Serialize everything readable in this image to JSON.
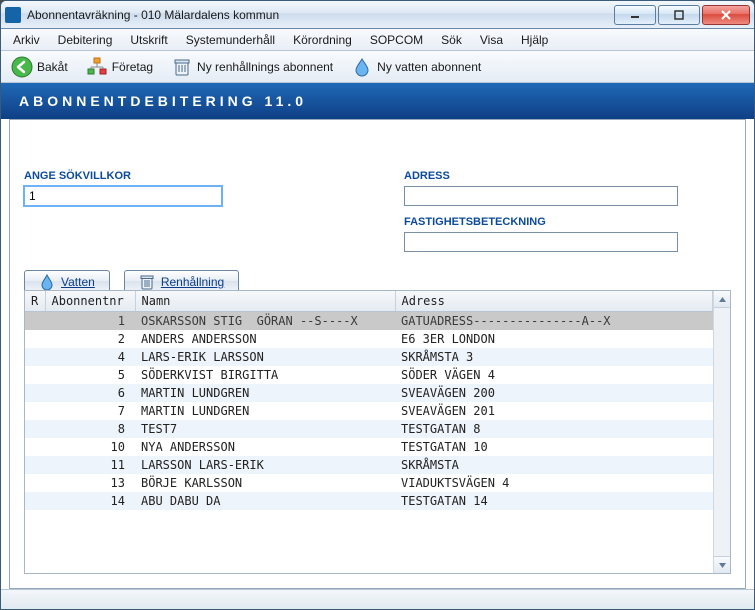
{
  "window": {
    "title": "Abonnentavräkning  -  010 Mälardalens kommun"
  },
  "menubar": [
    "Arkiv",
    "Debitering",
    "Utskrift",
    "Systemunderhåll",
    "Körordning",
    "SOPCOM",
    "Sök",
    "Visa",
    "Hjälp"
  ],
  "toolbar": {
    "back": "Bakåt",
    "company": "Företag",
    "new_ren": "Ny renhållnings abonnent",
    "new_vatten": "Ny vatten abonnent"
  },
  "band": "ABONNENTDEBITERING  11.0",
  "form": {
    "search_label": "ANGE SÖKVILLKOR",
    "search_value": "1",
    "adress_label": "ADRESS",
    "adress_value": "",
    "fast_label": "FASTIGHETSBETECKNING",
    "fast_value": "",
    "btn_vatten": "Vatten",
    "btn_ren": "Renhållning"
  },
  "table": {
    "headers": {
      "r": "R",
      "nr": "Abonnentnr",
      "namn": "Namn",
      "adress": "Adress"
    },
    "rows": [
      {
        "nr": "1",
        "namn": "OSKARSSON STIG  GÖRAN --S----X",
        "adress": "GATUADRESS---------------A--X",
        "sel": true
      },
      {
        "nr": "2",
        "namn": "ANDERS ANDERSSON",
        "adress": "E6 3ER LONDON"
      },
      {
        "nr": "4",
        "namn": "LARS-ERIK LARSSON",
        "adress": "SKRÅMSTA 3"
      },
      {
        "nr": "5",
        "namn": "SÖDERKVIST BIRGITTA",
        "adress": "SÖDER VÄGEN 4"
      },
      {
        "nr": "6",
        "namn": "MARTIN LUNDGREN",
        "adress": "SVEAVÄGEN 200"
      },
      {
        "nr": "7",
        "namn": "MARTIN LUNDGREN",
        "adress": "SVEAVÄGEN 201"
      },
      {
        "nr": "8",
        "namn": "TEST7",
        "adress": "TESTGATAN 8"
      },
      {
        "nr": "10",
        "namn": "NYA ANDERSSON",
        "adress": "TESTGATAN 10"
      },
      {
        "nr": "11",
        "namn": "LARSSON LARS-ERIK",
        "adress": "SKRÅMSTA"
      },
      {
        "nr": "13",
        "namn": "BÖRJE KARLSSON",
        "adress": "VIADUKTSVÄGEN 4"
      },
      {
        "nr": "14",
        "namn": "ABU DABU DA",
        "adress": "TESTGATAN 14"
      }
    ]
  }
}
